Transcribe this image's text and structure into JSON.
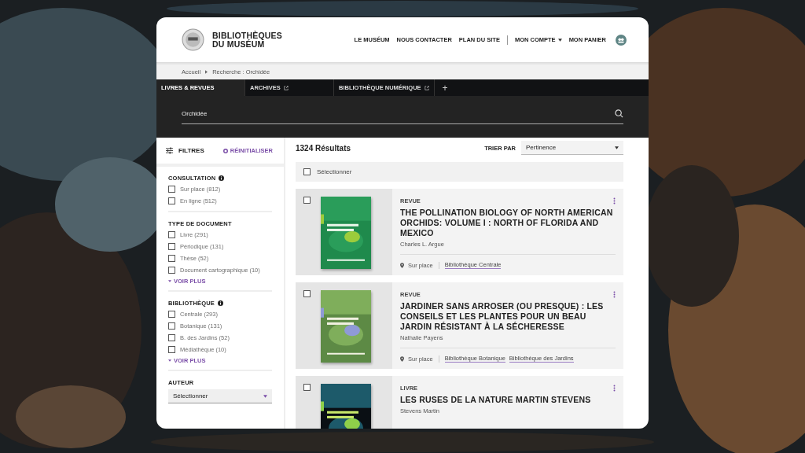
{
  "header": {
    "logo_lines": [
      "BIBLIOTHÈQUES",
      "DU MUSÉUM"
    ],
    "nav_primary": [
      "LE MUSÉUM",
      "NOUS CONTACTER",
      "PLAN DU SITE"
    ],
    "nav_account": [
      {
        "label": "MON COMPTE",
        "kind": "dropdown"
      },
      {
        "label": "MON PANIER",
        "kind": "link"
      }
    ]
  },
  "breadcrumb": [
    "Accueil",
    "Recherche : Orchidée"
  ],
  "tabs": [
    {
      "label": "LIVRES & REVUES",
      "selected": true
    },
    {
      "label": "ARCHIVES",
      "selected": false,
      "external": true
    },
    {
      "label": "BIBLIOTHÈQUE NUMÉRIQUE",
      "selected": false,
      "external": true
    }
  ],
  "add_tab": "+",
  "search": {
    "value": "Orchidée"
  },
  "filters": {
    "title": "FILTRES",
    "reset": "RÉINITIALISER",
    "groups": [
      {
        "title": "CONSULTATION",
        "info": true,
        "options": [
          {
            "label": "Sur place (812)",
            "checked": false
          },
          {
            "label": "En ligne (512)",
            "checked": false
          }
        ]
      },
      {
        "title": "TYPE DE DOCUMENT",
        "options": [
          {
            "label": "Livre (291)",
            "checked": false
          },
          {
            "label": "Périodique (131)",
            "checked": false
          },
          {
            "label": "Thèse (52)",
            "checked": false
          },
          {
            "label": "Document cartographique (10)",
            "checked": false
          }
        ],
        "more": "VOIR PLUS"
      },
      {
        "title": "BIBLIOTHÈQUE",
        "info": true,
        "options": [
          {
            "label": "Centrale (293)",
            "checked": false
          },
          {
            "label": "Botanique (131)",
            "checked": false
          },
          {
            "label": "B. des  Jardins (52)",
            "checked": false
          },
          {
            "label": "Médiathèque (10)",
            "checked": false
          }
        ],
        "more": "VOIR PLUS"
      }
    ],
    "author": {
      "title": "AUTEUR",
      "value": "Sélectionner"
    }
  },
  "results": {
    "count": "1324 Résultats",
    "sort_label": "TRIER PAR",
    "sort_value": "Pertinence",
    "select_all": {
      "label": "Sélectionner",
      "checked": false
    },
    "items": [
      {
        "type": "REVUE",
        "title": "THE POLLINATION BIOLOGY OF NORTH AMERICAN ORCHIDS: VOLUME I : NORTH OF FLORIDA AND MEXICO",
        "author": "Charles L. Argue",
        "checked": false,
        "availability": "Sur place",
        "libraries": [
          "Bibliothèque Centrale"
        ]
      },
      {
        "type": "REVUE",
        "title": "JARDINER SANS ARROSER (OU PRESQUE) : LES CONSEILS ET LES PLANTES POUR UN BEAU JARDIN RÉSISTANT À LA SÉCHERESSE",
        "author": "Nathalie Payens",
        "checked": false,
        "availability": "Sur place",
        "libraries": [
          "Bibliothèque Botanique",
          "Bibliothèque des Jardins"
        ]
      },
      {
        "type": "LIVRE",
        "title": "LES RUSES DE LA NATURE MARTIN STEVENS",
        "author": "Stevens Martin",
        "checked": false
      }
    ]
  }
}
